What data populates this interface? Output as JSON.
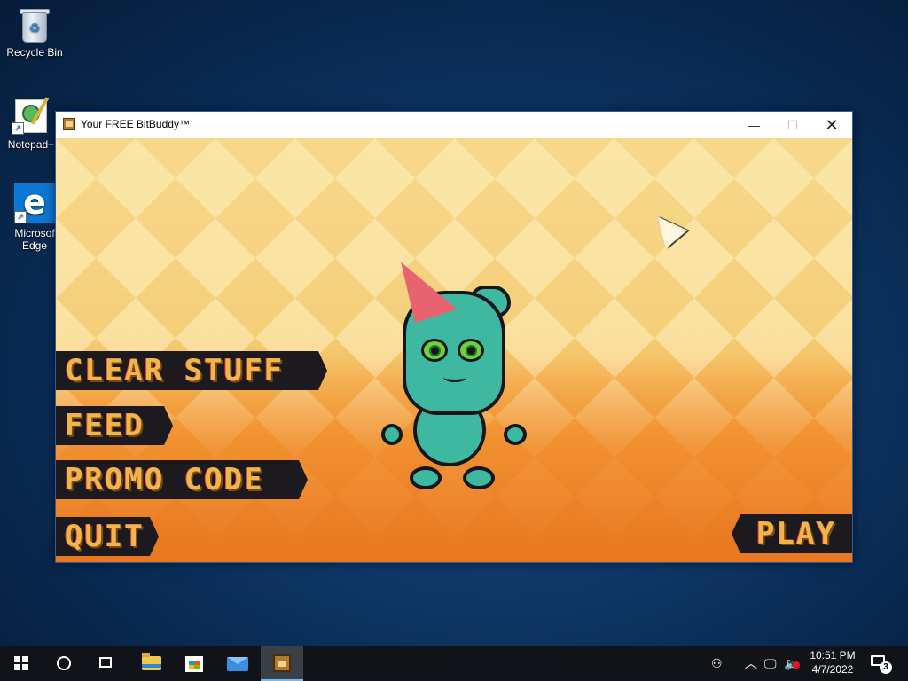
{
  "desktop": {
    "icons": [
      {
        "label": "Recycle Bin",
        "icon": "recycle-bin-icon"
      },
      {
        "label": "Notepad+",
        "icon": "notepad-plus-icon"
      },
      {
        "label": "Microsoft Edge",
        "label_line1": "Microsof",
        "label_line2": "Edge",
        "icon": "edge-icon"
      }
    ]
  },
  "window": {
    "title": "Your FREE BitBuddy™",
    "controls": {
      "minimize": "—",
      "maximize": "☐",
      "close": "✕"
    }
  },
  "game": {
    "menu": {
      "clear_stuff": "CLEAR STUFF",
      "feed": "FEED",
      "promo_code": "PROMO CODE",
      "quit": "QUIT",
      "play": "PLAY"
    },
    "character": "bitbuddy-character",
    "colors": {
      "buddy": "#3fb8a2",
      "hat": "#e8636f",
      "button_bg": "#1d1a1f",
      "button_text": "#f1b54a"
    }
  },
  "taskbar": {
    "apps": [
      "start-icon",
      "search-icon",
      "task-view-icon",
      "file-explorer-icon",
      "microsoft-store-icon",
      "mail-icon",
      "bitbuddy-icon"
    ],
    "clock_time": "10:51 PM",
    "clock_date": "4/7/2022",
    "notification_count": "3"
  }
}
